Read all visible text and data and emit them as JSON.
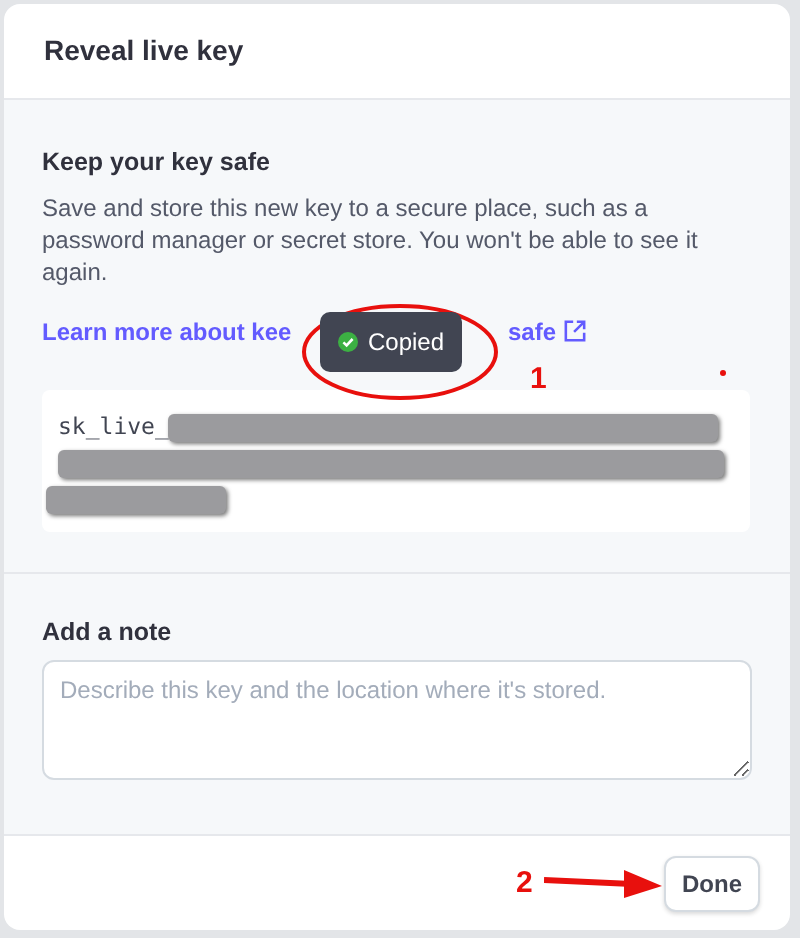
{
  "dialog": {
    "title": "Reveal live key"
  },
  "key_section": {
    "heading": "Keep your key safe",
    "description": "Save and store this new key to a secure place, such as a password manager or secret store. You won't be able to see it again.",
    "link": {
      "text_before": "Learn more about kee",
      "text_after": "safe"
    },
    "toast": {
      "text": "Copied"
    },
    "key_prefix": "sk_live_"
  },
  "note_section": {
    "heading": "Add a note",
    "placeholder": "Describe this key and the location where it's stored."
  },
  "annotations": [
    {
      "number": "1"
    },
    {
      "number": "2"
    }
  ],
  "buttons": [
    {
      "label": "Done"
    }
  ]
}
